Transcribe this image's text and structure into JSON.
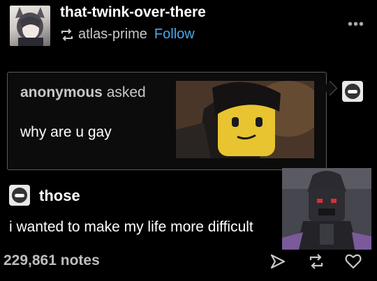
{
  "post": {
    "author": "that-twink-over-there",
    "reblogged_from": "atlas-prime",
    "follow_label": "Follow",
    "more_label": "•••"
  },
  "ask": {
    "asker": "anonymous",
    "asked_label": "asked",
    "question": "why are u gay"
  },
  "reply": {
    "author": "those",
    "text": "i wanted to make my life more difficult"
  },
  "footer": {
    "notes": "229,861 notes"
  },
  "colors": {
    "background": "#000000",
    "follow": "#4aa8e8",
    "muted": "#c8c8c8"
  },
  "icons": [
    "reblog-icon",
    "more-icon",
    "share-icon",
    "heart-icon"
  ]
}
